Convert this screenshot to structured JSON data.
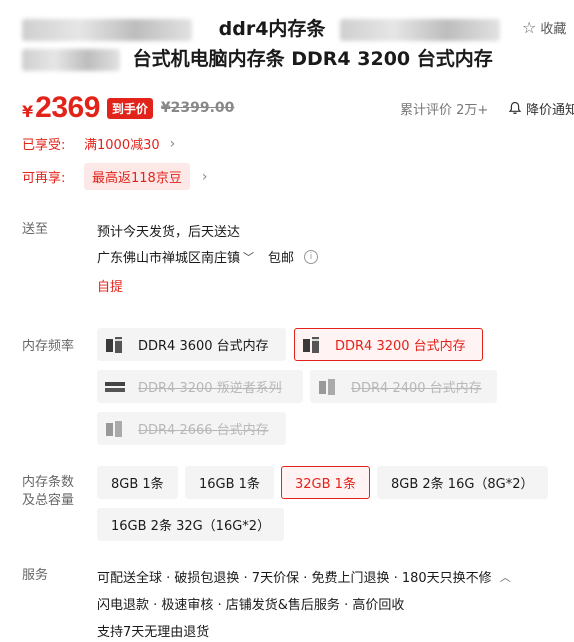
{
  "product": {
    "title_line1": "ddr4内存条",
    "title_line2": "台式机电脑内存条 DDR4 3200 台式内存",
    "favorite_label": "收藏"
  },
  "price": {
    "currency": "¥",
    "current": "2369",
    "tag": "到手价",
    "original": "¥2399.00",
    "reviews": "累计评价 2万+",
    "price_alert": "降价通知"
  },
  "promotions": {
    "enjoyed_label": "已享受:",
    "enjoyed_text": "满1000减30",
    "more_label": "可再享:",
    "more_text": "最高返118京豆"
  },
  "delivery": {
    "label": "送至",
    "eta": "预计今天发货，后天送达",
    "address": "广东佛山市禅城区南庄镇",
    "free_shipping": "包邮",
    "pickup": "自提"
  },
  "frequency": {
    "label": "内存频率",
    "options": [
      {
        "label": "DDR4 3600 台式内存",
        "state": "normal"
      },
      {
        "label": "DDR4 3200 台式内存",
        "state": "selected"
      },
      {
        "label": "DDR4 3200 叛逆者系列",
        "state": "disabled"
      },
      {
        "label": "DDR4 2400 台式内存",
        "state": "disabled"
      },
      {
        "label": "DDR4 2666 台式内存",
        "state": "disabled"
      }
    ]
  },
  "capacity": {
    "label_line1": "内存条数",
    "label_line2": "及总容量",
    "options": [
      {
        "label": "8GB 1条",
        "state": "normal"
      },
      {
        "label": "16GB 1条",
        "state": "normal"
      },
      {
        "label": "32GB 1条",
        "state": "selected"
      },
      {
        "label": "8GB 2条 16G（8G*2）",
        "state": "normal"
      },
      {
        "label": "16GB 2条 32G（16G*2）",
        "state": "normal"
      }
    ]
  },
  "services": {
    "label": "服务",
    "line1": "可配送全球 · 破损包退换 · 7天价保 · 免费上门退换 · 180天只换不修",
    "line2": "闪电退款 · 极速审核 · 店铺发货&售后服务 · 高价回收",
    "line3": "支持7天无理由退货"
  },
  "colors": {
    "accent": "#e2231a",
    "selected_bg": "#fff3f3",
    "option_bg": "#f4f4f5"
  }
}
